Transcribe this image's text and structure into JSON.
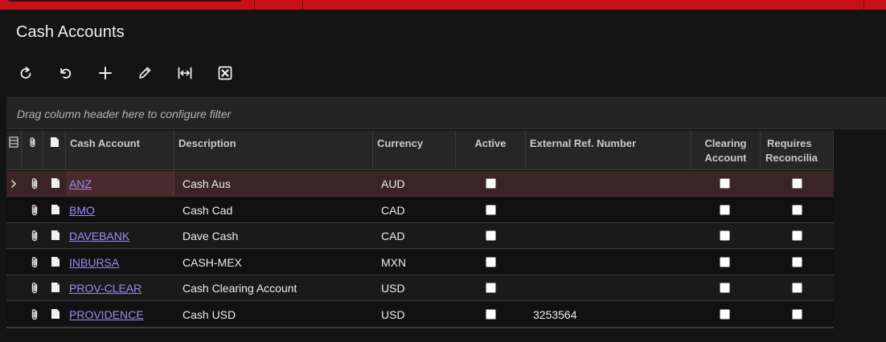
{
  "page": {
    "title": "Cash Accounts",
    "accent_color": "#c8101a"
  },
  "toolbar": {
    "buttons": [
      {
        "name": "refresh",
        "icon": "refresh-icon"
      },
      {
        "name": "undo",
        "icon": "undo-icon"
      },
      {
        "name": "add",
        "icon": "plus-icon"
      },
      {
        "name": "edit",
        "icon": "pencil-icon"
      },
      {
        "name": "fit-columns",
        "icon": "fit-width-icon"
      },
      {
        "name": "export-excel",
        "icon": "excel-icon"
      }
    ]
  },
  "filter": {
    "hint": "Drag column header here to configure filter"
  },
  "grid": {
    "columns": {
      "cash_account": "Cash Account",
      "description": "Description",
      "currency": "Currency",
      "active": "Active",
      "ext_ref": "External Ref. Number",
      "clearing_1": "Clearing",
      "clearing_2": "Account",
      "requires_1": "Requires",
      "requires_2": "Reconcilia"
    },
    "rows": [
      {
        "cash_account": "ANZ",
        "description": "Cash Aus",
        "currency": "AUD",
        "active": false,
        "ext_ref": "",
        "clearing": false,
        "requires": false
      },
      {
        "cash_account": "BMO",
        "description": "Cash Cad",
        "currency": "CAD",
        "active": false,
        "ext_ref": "",
        "clearing": false,
        "requires": false
      },
      {
        "cash_account": "DAVEBANK",
        "description": "Dave Cash",
        "currency": "CAD",
        "active": false,
        "ext_ref": "",
        "clearing": false,
        "requires": false
      },
      {
        "cash_account": "INBURSA",
        "description": "CASH-MEX",
        "currency": "MXN",
        "active": false,
        "ext_ref": "",
        "clearing": false,
        "requires": false
      },
      {
        "cash_account": "PROV-CLEAR",
        "description": "Cash Clearing Account",
        "currency": "USD",
        "active": false,
        "ext_ref": "",
        "clearing": false,
        "requires": false
      },
      {
        "cash_account": "PROVIDENCE",
        "description": "Cash USD",
        "currency": "USD",
        "active": false,
        "ext_ref": "3253564",
        "clearing": false,
        "requires": false
      }
    ]
  }
}
